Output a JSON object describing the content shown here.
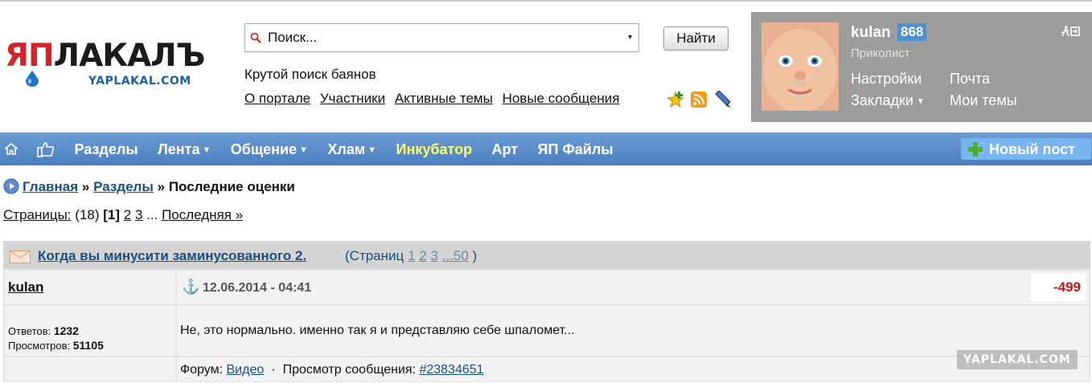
{
  "logo": {
    "big_ya": "ЯП",
    "big_rest": "ЛАКАЛЪ",
    "small": "YAPLAKAL.COM"
  },
  "search": {
    "placeholder": "Поиск...",
    "button_label": "Найти"
  },
  "slogan": "Крутой поиск баянов",
  "top_links": [
    "О портале",
    "Участники",
    "Активные темы",
    "Новые сообщения"
  ],
  "top_icons": [
    "favorite-star-icon",
    "rss-icon",
    "edit-pencil-icon"
  ],
  "user": {
    "name": "kulan",
    "karma": "868",
    "rank": "Приколист",
    "settings": "Настройки",
    "mail": "Почта",
    "bookmarks": "Закладки",
    "my_topics": "Мои темы"
  },
  "nav": {
    "items": [
      {
        "label": "Разделы",
        "dropdown": false
      },
      {
        "label": "Лента",
        "dropdown": true
      },
      {
        "label": "Общение",
        "dropdown": true
      },
      {
        "label": "Хлам",
        "dropdown": true
      },
      {
        "label": "Инкубатор",
        "dropdown": false,
        "color": "#ffff66"
      },
      {
        "label": "Арт",
        "dropdown": false
      },
      {
        "label": "ЯП Файлы",
        "dropdown": false
      }
    ],
    "new_post": "Новый пост"
  },
  "breadcrumb": {
    "home": "Главная",
    "sections": "Разделы",
    "current": "Последние оценки",
    "sep": "»"
  },
  "pages": {
    "label": "Страницы:",
    "count": "(18)",
    "current": "[1]",
    "p2": "2",
    "p3": "3",
    "ellipsis": "...",
    "last": "Последняя »"
  },
  "post": {
    "topic_title": "Когда вы минусити заминусованного 2.",
    "topic_pages_prefix": "(Страниц",
    "topic_pages": [
      "1",
      "2",
      "3",
      "...50"
    ],
    "topic_pages_suffix": ")",
    "author": "kulan",
    "date": "12.06.2014 - 04:41",
    "rating": "-499",
    "replies_label": "Ответов:",
    "replies": "1232",
    "views_label": "Просмотров:",
    "views": "51105",
    "text": "Не, это нормально. именно так я и представляю себе шпаломет...",
    "forum_label": "Форум:",
    "forum": "Видео",
    "view_label": "Просмотр сообщения:",
    "message_id": "#23834651"
  },
  "watermark": "YAPLAKAL.COM",
  "colors": {
    "nav_bg": "#5a8cc8",
    "incubator": "#ffff66",
    "rating": "#cc1111",
    "link": "#1a4f82",
    "karma_badge": "#4e8fd0"
  }
}
